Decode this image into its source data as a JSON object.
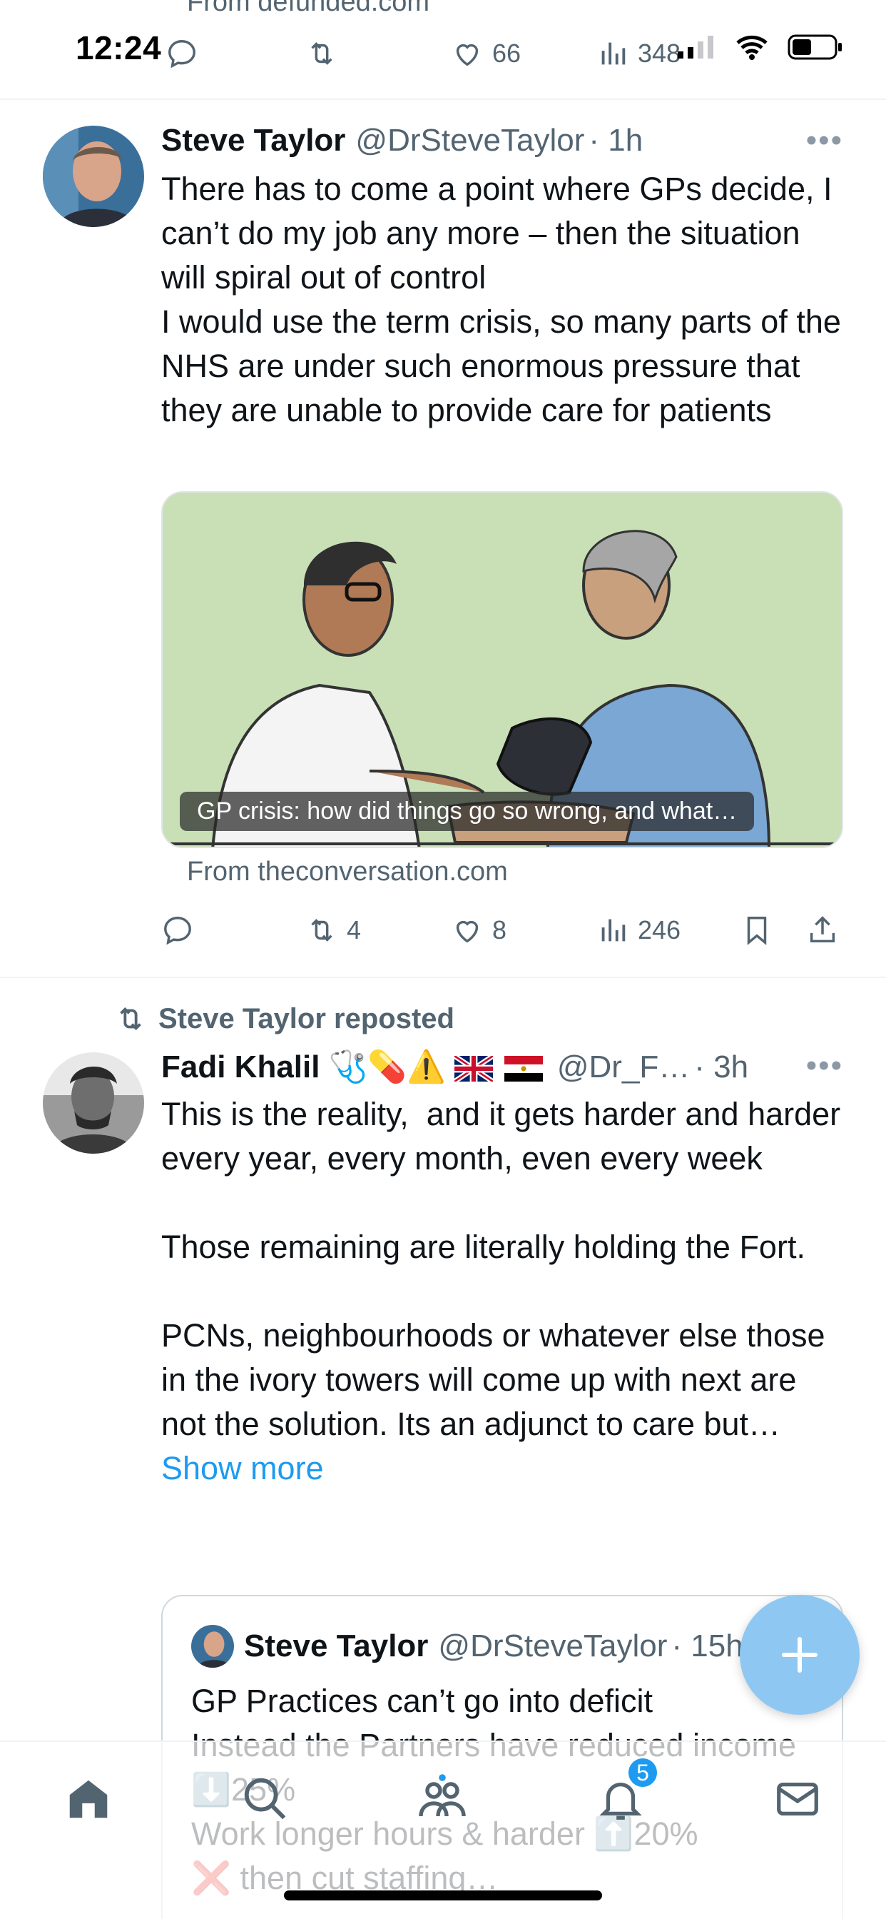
{
  "status_bar": {
    "time": "12:24"
  },
  "previous_tweet": {
    "source": "From defunded.com",
    "actions": {
      "likes": "66",
      "views": "348"
    }
  },
  "tweet1": {
    "name": "Steve Taylor",
    "handle": "@DrSteveTaylor",
    "time": "· 1h",
    "text": "There has to come a point where GPs decide, I can’t do my job any more – then the situation will spiral out of control\nI would use the term crisis, so many parts of the NHS are under such enormous pressure that they are unable to provide care for patients",
    "card": {
      "caption": "GP crisis: how did things go so wrong, and what…",
      "source": "From theconversation.com"
    },
    "actions": {
      "retweets": "4",
      "likes": "8",
      "views": "246"
    }
  },
  "tweet2": {
    "repost_label": "Steve Taylor reposted",
    "name": "Fadi Khalil",
    "handle": "@Dr_F…",
    "time": "· 3h",
    "emoji": "🩺💊⚠️",
    "text": "This is the reality,  and it gets harder and harder every year, every month, even every week\n\nThose remaining are literally holding the Fort.\n\nPCNs, neighbourhoods or whatever else those in the ivory towers will come up with next are not the solution. Its an adjunct to care but… ",
    "show_more": "Show more",
    "quote": {
      "name": "Steve Taylor",
      "handle": "@DrSteveTaylor",
      "time": "· 15h",
      "text": "GP Practices can’t go into deficit\nInstead the Partners have reduced income ⬇️25%\nWork longer hours & harder ⬆️20%\n❌ then cut staffing…"
    }
  },
  "tab_bar": {
    "notifications_badge": "5"
  },
  "colors": {
    "accent": "#1d9bf0",
    "secondary_text": "#536471",
    "fab": "#8ec8f2"
  },
  "icons": [
    "reply-icon",
    "retweet-icon",
    "like-icon",
    "views-icon",
    "bookmark-icon",
    "share-icon",
    "home-icon",
    "search-icon",
    "communities-icon",
    "notifications-icon",
    "messages-icon",
    "compose-icon"
  ]
}
